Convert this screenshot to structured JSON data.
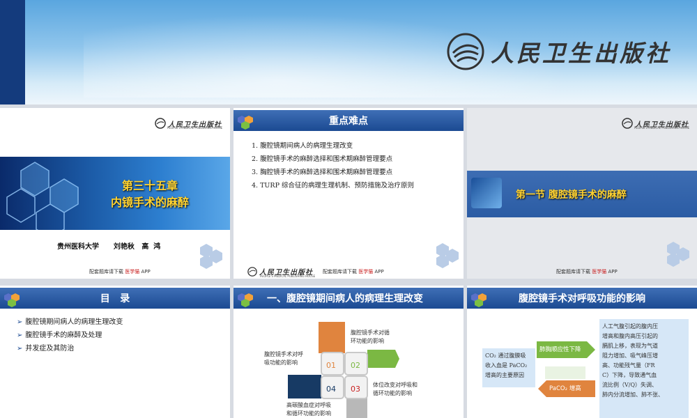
{
  "header": {
    "publisher": "人民卫生出版社"
  },
  "slide1": {
    "logo": "人民卫生出版社",
    "logo_sub": "PEOPLE'S MEDICAL PUBLISHING HOUSE",
    "chapter_line1": "第三十五章",
    "chapter_line2": "内镜手术的麻醉",
    "authors": "贵州医科大学      刘艳秋   高  鸿",
    "app_prefix": "配套题库请下载 ",
    "app_name": "医学猫",
    "app_suffix": " APP"
  },
  "slide2": {
    "title": "重点难点",
    "items": [
      "1. 腹腔镜期间病人的病理生理改变",
      "2. 腹腔镜手术的麻醉选择和围术期麻醉管理要点",
      "3. 胸腔镜手术的麻醉选择和围术期麻醉管理要点",
      "4. TURP 综合征的病理生理机制、预防措施及治疗原则"
    ],
    "logo": "人民卫生出版社",
    "logo_sub": "PEOPLE'S MEDICAL PUBLISHING HOUSE",
    "app_prefix": "配套题库请下载 ",
    "app_name": "医学猫",
    "app_suffix": " APP"
  },
  "slide3": {
    "logo": "人民卫生出版社",
    "logo_sub": "PEOPLE'S MEDICAL PUBLISHING HOUSE",
    "section": "第一节  腹腔镜手术的麻醉",
    "app_prefix": "配套题库请下载 ",
    "app_name": "医学猫",
    "app_suffix": " APP"
  },
  "slide4": {
    "title": "目   录",
    "items": [
      "腹腔镜期间病人的病理生理改变",
      "腹腔镜手术的麻醉及处理",
      "并发症及其防治"
    ]
  },
  "slide5": {
    "title": "一、腹腔镜期间病人的病理生理改变",
    "n1": "01",
    "n2": "02",
    "n3": "03",
    "n4": "04",
    "l1": "腹腔镜手术对呼\n吸功能的影响",
    "l2": "腹腔镜手术对循\n环功能的影响",
    "l3": "体位改变对呼吸和\n循环功能的影响",
    "l4": "高碳酸血症对呼吸\n和循环功能的影响"
  },
  "slide6": {
    "title": "腹腔镜手术对呼吸功能的影响",
    "left_box": "CO₂ 通过腹膜吸\n收入血是 PaCO₂\n增高的主要原因",
    "arrow_top": "肺胸顺应性下降",
    "arrow_bottom": "PaCO₂ 增高",
    "right_box": "人工气腹引起的腹内压\n增高和腹内高压引起的\n膈肌上移，表现为气道\n阻力增加、吸气峰压增\n高、功能残气量（FR\nC）下降，导致通气血\n流比例（V/Q）失调、\n肺内分流增加、肺不张、"
  }
}
